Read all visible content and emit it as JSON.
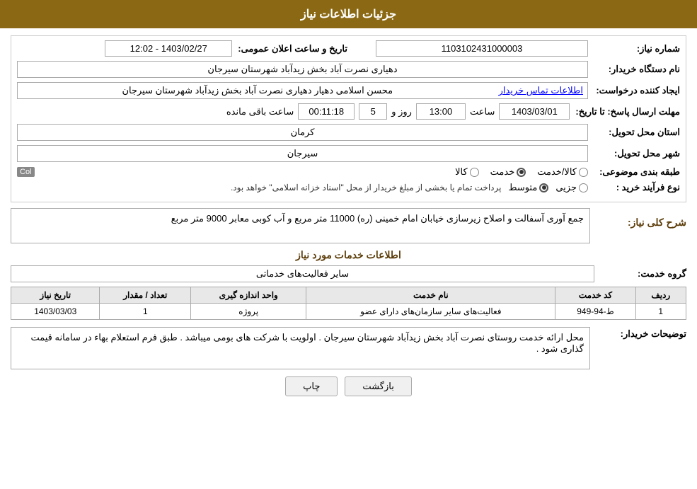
{
  "header": {
    "title": "جزئیات اطلاعات نیاز"
  },
  "fields": {
    "need_number_label": "شماره نیاز:",
    "need_number_value": "1103102431000003",
    "buyer_org_label": "نام دستگاه خریدار:",
    "buyer_org_value": "دهیاری نصرت آباد بخش زیدآباد شهرستان سیرجان",
    "creator_label": "ایجاد کننده درخواست:",
    "creator_value": "محسن اسلامی دهیار دهیاری نصرت آباد بخش زیدآباد شهرستان سیرجان",
    "contact_link": "اطلاعات تماس خریدار",
    "deadline_label": "مهلت ارسال پاسخ: تا تاریخ:",
    "deadline_date": "1403/03/01",
    "deadline_time_label": "ساعت",
    "deadline_time": "13:00",
    "deadline_day_label": "روز و",
    "deadline_days": "5",
    "deadline_remaining_label": "ساعت باقی مانده",
    "deadline_remaining": "00:11:18",
    "announce_label": "تاریخ و ساعت اعلان عمومی:",
    "announce_value": "1403/02/27 - 12:02",
    "province_label": "استان محل تحویل:",
    "province_value": "کرمان",
    "city_label": "شهر محل تحویل:",
    "city_value": "سیرجان",
    "category_label": "طبقه بندی موضوعی:",
    "category_goods": "کالا",
    "category_service": "خدمت",
    "category_goods_service": "کالا/خدمت",
    "category_selected": "خدمت",
    "purchase_type_label": "نوع فرآیند خرید :",
    "purchase_partial": "جزیی",
    "purchase_medium": "متوسط",
    "purchase_note": "پرداخت تمام یا بخشی از مبلغ خریدار از محل \"اسناد خزانه اسلامی\" خواهد بود.",
    "purchase_selected": "متوسط"
  },
  "need_description": {
    "section_title": "شرح کلی نیاز:",
    "description": "جمع آوری آسفالت و اصلاح زیرسازی خیابان امام خمینی (ره) 11000 متر مربع و آب کوبی معابر 9000 متر مربع"
  },
  "services_info": {
    "section_title": "اطلاعات خدمات مورد نیاز",
    "service_group_label": "گروه خدمت:",
    "service_group_value": "سایر فعالیت‌های خدماتی",
    "table": {
      "headers": [
        "ردیف",
        "کد خدمت",
        "نام خدمت",
        "واحد اندازه گیری",
        "تعداد / مقدار",
        "تاریخ نیاز"
      ],
      "rows": [
        {
          "row_num": "1",
          "service_code": "ط-94-949",
          "service_name": "فعالیت‌های سایر سازمان‌های دارای عضو",
          "unit": "پروژه",
          "quantity": "1",
          "date": "1403/03/03"
        }
      ]
    }
  },
  "buyer_notes": {
    "label": "توضیحات خریدار:",
    "text": "محل ارائه خدمت روستای نصرت آباد بخش زیدآباد شهرستان سیرجان . اولویت با شرکت های بومی میباشد . طبق فرم استعلام بهاء در سامانه قیمت گذاری شود ."
  },
  "buttons": {
    "print_label": "چاپ",
    "back_label": "بازگشت"
  },
  "col_badge": "Col"
}
